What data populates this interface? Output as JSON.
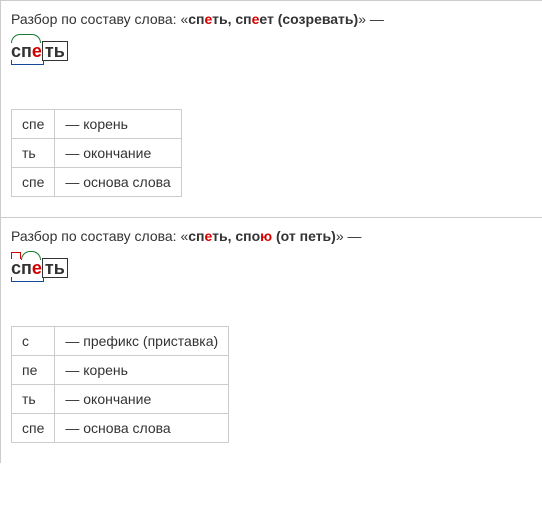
{
  "sections": [
    {
      "heading_prefix": "Разбор по составу слова: «",
      "word_plain_pre": "сп",
      "word_stress": "е",
      "word_plain_mid": "ть, сп",
      "word_stress2": "е",
      "word_plain_post": "ет (созревать)",
      "heading_suffix": "» —",
      "display": {
        "pre_root": "",
        "root_pre": "сп",
        "root_stress": "е",
        "root_post": "",
        "ending": "ть"
      },
      "rows": [
        {
          "k": "спе",
          "v": "— корень"
        },
        {
          "k": "ть",
          "v": "— окончание"
        },
        {
          "k": "спе",
          "v": "— основа слова"
        }
      ]
    },
    {
      "heading_prefix": "Разбор по составу слова: «",
      "word_plain_pre": "сп",
      "word_stress": "е",
      "word_plain_mid": "ть, спо",
      "word_stress2": "ю",
      "word_plain_post": " (от петь)",
      "heading_suffix": "» —",
      "display": {
        "pre_root": "с",
        "root_pre": "п",
        "root_stress": "е",
        "root_post": "",
        "ending": "ть"
      },
      "rows": [
        {
          "k": "с",
          "v": "— префикс (приставка)"
        },
        {
          "k": "пе",
          "v": "— корень"
        },
        {
          "k": "ть",
          "v": "— окончание"
        },
        {
          "k": "спе",
          "v": "— основа слова"
        }
      ]
    }
  ]
}
